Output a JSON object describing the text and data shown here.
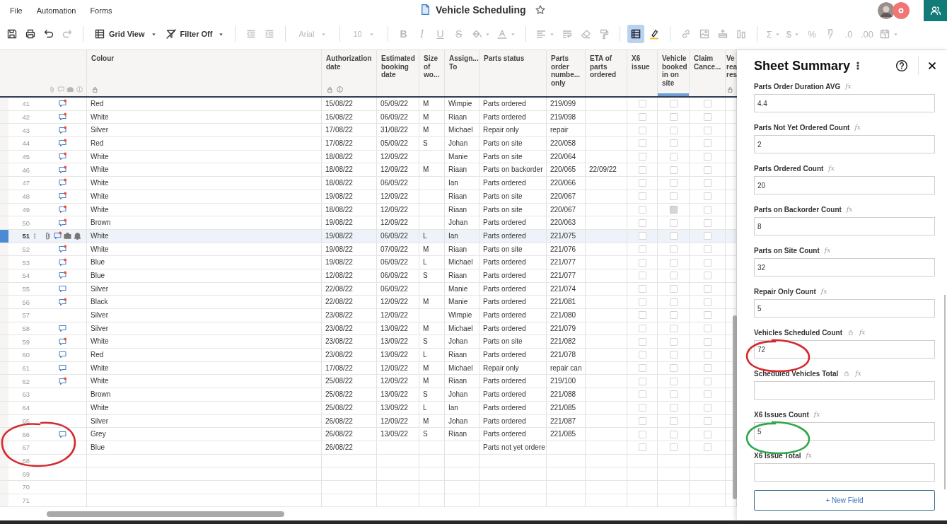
{
  "menu": [
    {
      "label": "File"
    },
    {
      "label": "Automation"
    },
    {
      "label": "Forms"
    }
  ],
  "title": "Vehicle Scheduling",
  "favorite": false,
  "toolbar": [
    {
      "kind": "save",
      "disabled": false
    },
    {
      "kind": "print",
      "disabled": false
    },
    {
      "kind": "undo",
      "disabled": false
    },
    {
      "kind": "redo",
      "disabled": true
    },
    {
      "kind": "separator"
    },
    {
      "kind": "view",
      "label": "Grid View",
      "menu": true,
      "disabled": false
    },
    {
      "kind": "filter",
      "label": "Filter Off",
      "menu": true,
      "disabled": false
    },
    {
      "kind": "separator"
    },
    {
      "kind": "outdent",
      "disabled": true
    },
    {
      "kind": "indent",
      "disabled": true
    },
    {
      "kind": "separator"
    },
    {
      "kind": "font",
      "label": "Arial",
      "menu": true,
      "disabled": true
    },
    {
      "kind": "separator"
    },
    {
      "kind": "font",
      "label": "10",
      "menu": true,
      "disabled": true
    },
    {
      "kind": "separator"
    },
    {
      "kind": "bold",
      "label": "B",
      "disabled": true
    },
    {
      "kind": "italic",
      "label": "I",
      "disabled": true
    },
    {
      "kind": "underline",
      "label": "U",
      "disabled": true
    },
    {
      "kind": "strike",
      "label": "S",
      "disabled": true
    },
    {
      "kind": "fill",
      "menu": true,
      "disabled": true
    },
    {
      "kind": "textcolor",
      "menu": true,
      "disabled": true
    },
    {
      "kind": "separator"
    },
    {
      "kind": "align",
      "menu": true,
      "disabled": true
    },
    {
      "kind": "wrap",
      "disabled": true
    },
    {
      "kind": "eraser",
      "disabled": true
    },
    {
      "kind": "painter",
      "disabled": true
    },
    {
      "kind": "separator"
    },
    {
      "kind": "sheetview",
      "selected": true,
      "disabled": false
    },
    {
      "kind": "highlight",
      "selected": false,
      "disabled": false
    },
    {
      "kind": "separator"
    },
    {
      "kind": "link",
      "disabled": true
    },
    {
      "kind": "image",
      "disabled": true
    },
    {
      "kind": "insertrow",
      "disabled": true
    },
    {
      "kind": "columns",
      "disabled": true
    },
    {
      "kind": "separator"
    },
    {
      "kind": "glyph",
      "label": "Σ",
      "menu": true,
      "disabled": true
    },
    {
      "kind": "glyph",
      "label": "$",
      "menu": true,
      "disabled": true
    },
    {
      "kind": "glyph",
      "label": "%",
      "disabled": true
    },
    {
      "kind": "numformat",
      "disabled": true
    },
    {
      "kind": "glyph",
      "label": ".0",
      "disabled": true
    },
    {
      "kind": "glyph",
      "label": ".00",
      "disabled": true
    },
    {
      "kind": "date",
      "menu": true,
      "disabled": true
    }
  ],
  "columns": [
    {
      "label": "Colour",
      "locked": true,
      "selected": false
    },
    {
      "label": "Authorization date",
      "locked": true,
      "info": true,
      "selected": false
    },
    {
      "label": "Estimated booking date",
      "selected": false
    },
    {
      "label": "Size of wo...",
      "selected": false
    },
    {
      "label": "Assign... To",
      "selected": false
    },
    {
      "label": "Parts status",
      "selected": false
    },
    {
      "label": "Parts order numbe... only",
      "selected": false
    },
    {
      "label": "ETA of parts ordered",
      "selected": false
    },
    {
      "label": "X6 issue",
      "selected": false
    },
    {
      "label": "Vehicle booked in on site",
      "selected": true
    },
    {
      "label": "Claim Cance...",
      "selected": false
    },
    {
      "label": "Ve rea res",
      "locked": true,
      "selected": false
    }
  ],
  "rows": [
    {
      "number": "41",
      "selected": false,
      "icons": [
        {
          "kind": "comment",
          "unread": true
        }
      ],
      "cells": [
        "Red",
        "15/08/22",
        "05/09/22",
        "M",
        "Wimpie",
        "Parts ordered",
        "219/099",
        null
      ],
      "checked": [
        false,
        false,
        false
      ]
    },
    {
      "number": "42",
      "selected": false,
      "icons": [
        {
          "kind": "comment",
          "unread": true
        }
      ],
      "cells": [
        "White",
        "16/08/22",
        "06/09/22",
        "M",
        "Riaan",
        "Parts ordered",
        "219/098",
        null
      ],
      "checked": [
        false,
        false,
        false
      ]
    },
    {
      "number": "43",
      "selected": false,
      "icons": [
        {
          "kind": "comment",
          "unread": true
        }
      ],
      "cells": [
        "Silver",
        "17/08/22",
        "31/08/22",
        "M",
        "Michael",
        "Repair only",
        "repair",
        null
      ],
      "checked": [
        false,
        false,
        false
      ]
    },
    {
      "number": "44",
      "selected": false,
      "icons": [
        {
          "kind": "comment",
          "unread": true
        }
      ],
      "cells": [
        "Red",
        "17/08/22",
        "05/09/22",
        "S",
        "Johan",
        "Parts on site",
        "220/058",
        null
      ],
      "checked": [
        false,
        false,
        false
      ]
    },
    {
      "number": "45",
      "selected": false,
      "icons": [
        {
          "kind": "comment",
          "unread": true
        }
      ],
      "cells": [
        "White",
        "18/08/22",
        "12/09/22",
        null,
        "Manie",
        "Parts on site",
        "220/064",
        null
      ],
      "checked": [
        false,
        false,
        false
      ]
    },
    {
      "number": "46",
      "selected": false,
      "icons": [
        {
          "kind": "comment",
          "unread": true
        }
      ],
      "cells": [
        "White",
        "18/08/22",
        "12/09/22",
        "M",
        "Riaan",
        "Parts on backorder",
        "220/065",
        "22/09/22"
      ],
      "checked": [
        false,
        false,
        false
      ]
    },
    {
      "number": "47",
      "selected": false,
      "icons": [
        {
          "kind": "comment",
          "unread": true
        }
      ],
      "cells": [
        "White",
        "18/08/22",
        "06/09/22",
        null,
        "Ian",
        "Parts ordered",
        "220/066",
        null
      ],
      "checked": [
        false,
        false,
        false
      ]
    },
    {
      "number": "48",
      "selected": false,
      "icons": [
        {
          "kind": "comment",
          "unread": true
        }
      ],
      "cells": [
        "White",
        "19/08/22",
        "12/09/22",
        null,
        "Riaan",
        "Parts on site",
        "220/067",
        null
      ],
      "checked": [
        false,
        false,
        false
      ]
    },
    {
      "number": "49",
      "selected": false,
      "icons": [
        {
          "kind": "comment",
          "unread": true
        }
      ],
      "cells": [
        "White",
        "18/08/22",
        "12/09/22",
        null,
        "Riaan",
        "Parts on site",
        "220/067",
        null
      ],
      "checked": [
        false,
        true,
        false
      ]
    },
    {
      "number": "50",
      "selected": false,
      "icons": [
        {
          "kind": "comment",
          "unread": true
        }
      ],
      "cells": [
        "Brown",
        "19/08/22",
        "12/09/22",
        null,
        "Johan",
        "Parts ordered",
        "220/063",
        null
      ],
      "checked": [
        false,
        false,
        false
      ]
    },
    {
      "number": "51",
      "selected": true,
      "icons": [
        {
          "kind": "attachment"
        },
        {
          "kind": "comment",
          "unread": true
        },
        {
          "kind": "proof"
        },
        {
          "kind": "reminder"
        }
      ],
      "cells": [
        "White",
        "19/08/22",
        "06/09/22",
        "L",
        "Ian",
        "Parts ordered",
        "221/075",
        null
      ],
      "checked": [
        false,
        false,
        false
      ]
    },
    {
      "number": "52",
      "selected": false,
      "icons": [
        {
          "kind": "comment",
          "unread": true
        }
      ],
      "cells": [
        "White",
        "19/08/22",
        "07/09/22",
        "M",
        "Riaan",
        "Parts on site",
        "221/076",
        null
      ],
      "checked": [
        false,
        false,
        false
      ]
    },
    {
      "number": "53",
      "selected": false,
      "icons": [
        {
          "kind": "comment",
          "unread": true
        }
      ],
      "cells": [
        "Blue",
        "19/08/22",
        "06/09/22",
        "L",
        "Michael",
        "Parts ordered",
        "221/077",
        null
      ],
      "checked": [
        false,
        false,
        false
      ]
    },
    {
      "number": "54",
      "selected": false,
      "icons": [
        {
          "kind": "comment",
          "unread": true
        }
      ],
      "cells": [
        "Blue",
        "12/08/22",
        "06/09/22",
        "S",
        "Riaan",
        "Parts ordered",
        "221/077",
        null
      ],
      "checked": [
        false,
        false,
        false
      ]
    },
    {
      "number": "55",
      "selected": false,
      "icons": [
        {
          "kind": "comment",
          "unread": false
        }
      ],
      "cells": [
        "Silver",
        "22/08/22",
        "06/09/22",
        null,
        "Manie",
        "Parts ordered",
        "221/074",
        null
      ],
      "checked": [
        false,
        false,
        false
      ]
    },
    {
      "number": "56",
      "selected": false,
      "icons": [
        {
          "kind": "comment",
          "unread": true
        }
      ],
      "cells": [
        "Black",
        "22/08/22",
        "12/09/22",
        "M",
        "Manie",
        "Parts ordered",
        "221/081",
        null
      ],
      "checked": [
        false,
        false,
        false
      ]
    },
    {
      "number": "57",
      "selected": false,
      "cells": [
        "Silver",
        "23/08/22",
        "12/09/22",
        null,
        "Wimpie",
        "Parts ordered",
        "221/080",
        null
      ],
      "checked": [
        false,
        false,
        false
      ]
    },
    {
      "number": "58",
      "selected": false,
      "icons": [
        {
          "kind": "comment",
          "unread": false
        }
      ],
      "cells": [
        "Silver",
        "23/08/22",
        "13/09/22",
        "M",
        "Michael",
        "Parts ordered",
        "221/079",
        null
      ],
      "checked": [
        false,
        false,
        false
      ]
    },
    {
      "number": "59",
      "selected": false,
      "icons": [
        {
          "kind": "comment",
          "unread": true
        }
      ],
      "cells": [
        "White",
        "23/08/22",
        "13/09/22",
        "S",
        "Johan",
        "Parts on site",
        "221/082",
        null
      ],
      "checked": [
        false,
        false,
        false
      ]
    },
    {
      "number": "60",
      "selected": false,
      "icons": [
        {
          "kind": "comment",
          "unread": false
        }
      ],
      "cells": [
        "Red",
        "23/08/22",
        "13/09/22",
        "L",
        "Riaan",
        "Parts ordered",
        "221/078",
        null
      ],
      "checked": [
        false,
        false,
        false
      ]
    },
    {
      "number": "61",
      "selected": false,
      "icons": [
        {
          "kind": "comment",
          "unread": false
        }
      ],
      "cells": [
        "White",
        "17/08/22",
        "12/09/22",
        "M",
        "Michael",
        "Repair only",
        "repair can",
        null
      ],
      "checked": [
        false,
        false,
        false
      ]
    },
    {
      "number": "62",
      "selected": false,
      "icons": [
        {
          "kind": "comment",
          "unread": true
        }
      ],
      "cells": [
        "White",
        "25/08/22",
        "12/09/22",
        "M",
        "Riaan",
        "Parts ordered",
        "219/100",
        null
      ],
      "checked": [
        false,
        false,
        false
      ]
    },
    {
      "number": "63",
      "selected": false,
      "cells": [
        "Brown",
        "25/08/22",
        "13/09/22",
        "S",
        "Johan",
        "Parts ordered",
        "221/088",
        null
      ],
      "checked": [
        false,
        false,
        false
      ]
    },
    {
      "number": "64",
      "selected": false,
      "cells": [
        "White",
        "25/08/22",
        "13/09/22",
        "L",
        "Ian",
        "Parts ordered",
        "221/085",
        null
      ],
      "checked": [
        false,
        false,
        false
      ]
    },
    {
      "number": "65",
      "selected": false,
      "cells": [
        "Silver",
        "26/08/22",
        "12/09/22",
        "M",
        "Johan",
        "Parts ordered",
        "221/087",
        null
      ],
      "checked": [
        false,
        false,
        false
      ]
    },
    {
      "number": "66",
      "selected": false,
      "icons": [
        {
          "kind": "comment",
          "unread": false
        }
      ],
      "annotation": {
        "color": "#d42a2e"
      },
      "cells": [
        "Grey",
        "26/08/22",
        "13/09/22",
        "S",
        "Riaan",
        "Parts ordered",
        "221/085",
        null
      ],
      "checked": [
        false,
        false,
        false
      ]
    },
    {
      "number": "67",
      "selected": false,
      "cells": [
        "Blue",
        "26/08/22",
        null,
        null,
        null,
        "Parts not yet ordere",
        null,
        null
      ],
      "checked": [
        false,
        false,
        false
      ]
    },
    {
      "number": "68",
      "selected": false
    },
    {
      "number": "69",
      "selected": false
    },
    {
      "number": "70",
      "selected": false
    },
    {
      "number": "71",
      "selected": false
    }
  ],
  "summary": {
    "title": "Sheet Summary",
    "fields": [
      {
        "label": "Parts Order Duration AVG",
        "formula": "fx",
        "value": "4.4"
      },
      {
        "label": "Parts Not Yet Ordered Count",
        "formula": "fx",
        "value": "2"
      },
      {
        "label": "Parts Ordered Count",
        "formula": "fx",
        "value": "20"
      },
      {
        "label": "Parts on Backorder Count",
        "formula": "fx",
        "value": "8"
      },
      {
        "label": "Parts on Site Count",
        "formula": "fx",
        "value": "32"
      },
      {
        "label": "Repair Only Count",
        "formula": "fx",
        "value": "5"
      },
      {
        "label": "Vehicles Scheduled Count",
        "formula": "fx",
        "locked": true,
        "value": "72",
        "annotation": {
          "color": "#d42a2e"
        }
      },
      {
        "label": "Scheduled Vehicles Total",
        "formula": "fx",
        "locked": true
      },
      {
        "label": "X6 Issues Count",
        "formula": "fx",
        "value": "5",
        "annotation": {
          "color": "#2fa84a"
        }
      },
      {
        "label": "X6 Issue Total",
        "formula": "fx"
      }
    ],
    "button": "+ New Field"
  }
}
